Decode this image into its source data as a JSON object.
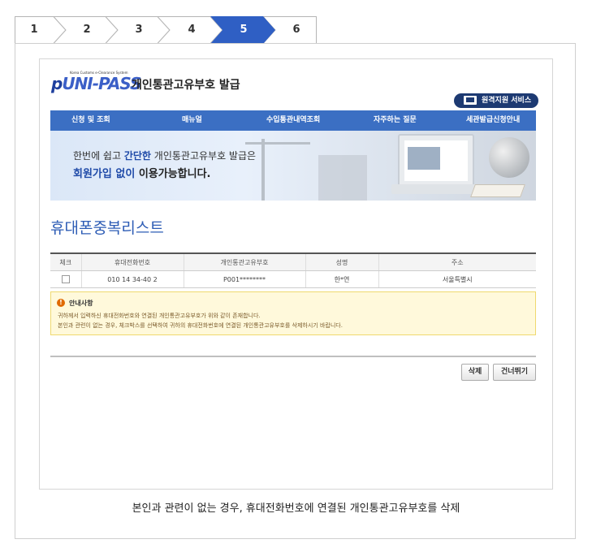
{
  "steps": [
    {
      "label": "1",
      "active": false
    },
    {
      "label": "2",
      "active": false
    },
    {
      "label": "3",
      "active": false
    },
    {
      "label": "4",
      "active": false
    },
    {
      "label": "5",
      "active": true
    },
    {
      "label": "6",
      "active": false
    }
  ],
  "colors": {
    "active_step": "#2f5fc4",
    "accent": "#3b6fc3",
    "title": "#2d5cb5"
  },
  "header": {
    "logo_tagline": "Korea Customs e-Clearance System",
    "logo_text_p": "p",
    "logo_text_rest": "UNI-PASS",
    "site_title": "개인통관고유부호 발급",
    "remote_service": "원격지원 서비스"
  },
  "nav": {
    "items": [
      "신청 및 조회",
      "매뉴얼",
      "수입통관내역조회",
      "자주하는 질문",
      "세관발급신청안내"
    ]
  },
  "banner": {
    "l1_pre": "한번에 쉽고 ",
    "l1_em": "간단한",
    "l1_post": " 개인통관고유부호 발급은",
    "l2_em": "회원가입 없이",
    "l2_post": " 이용가능합니다."
  },
  "page_title": "휴대폰중복리스트",
  "table": {
    "headers": [
      "체크",
      "휴대전화번호",
      "개인통관고유부호",
      "성명",
      "주소"
    ],
    "rows": [
      {
        "phone": "010 14 34-40 2",
        "code": "P001********",
        "name": "한*연",
        "address": "서울특별시"
      }
    ]
  },
  "notice": {
    "title": "안내사항",
    "line1": "귀하께서 입력하신 휴대전화번호와 연결된 개인통관고유부호가 위와 같이 존재합니다.",
    "line2": "본인과 관련이 없는 경우, 체크박스를 선택하여 귀하의 휴대전화번호에 연결된 개인통관고유부호를 삭제하시기 바랍니다."
  },
  "buttons": {
    "delete": "삭제",
    "skip": "건너뛰기"
  },
  "caption": "본인과 관련이 없는 경우, 휴대전화번호에 연결된 개인통관고유부호를 삭제"
}
